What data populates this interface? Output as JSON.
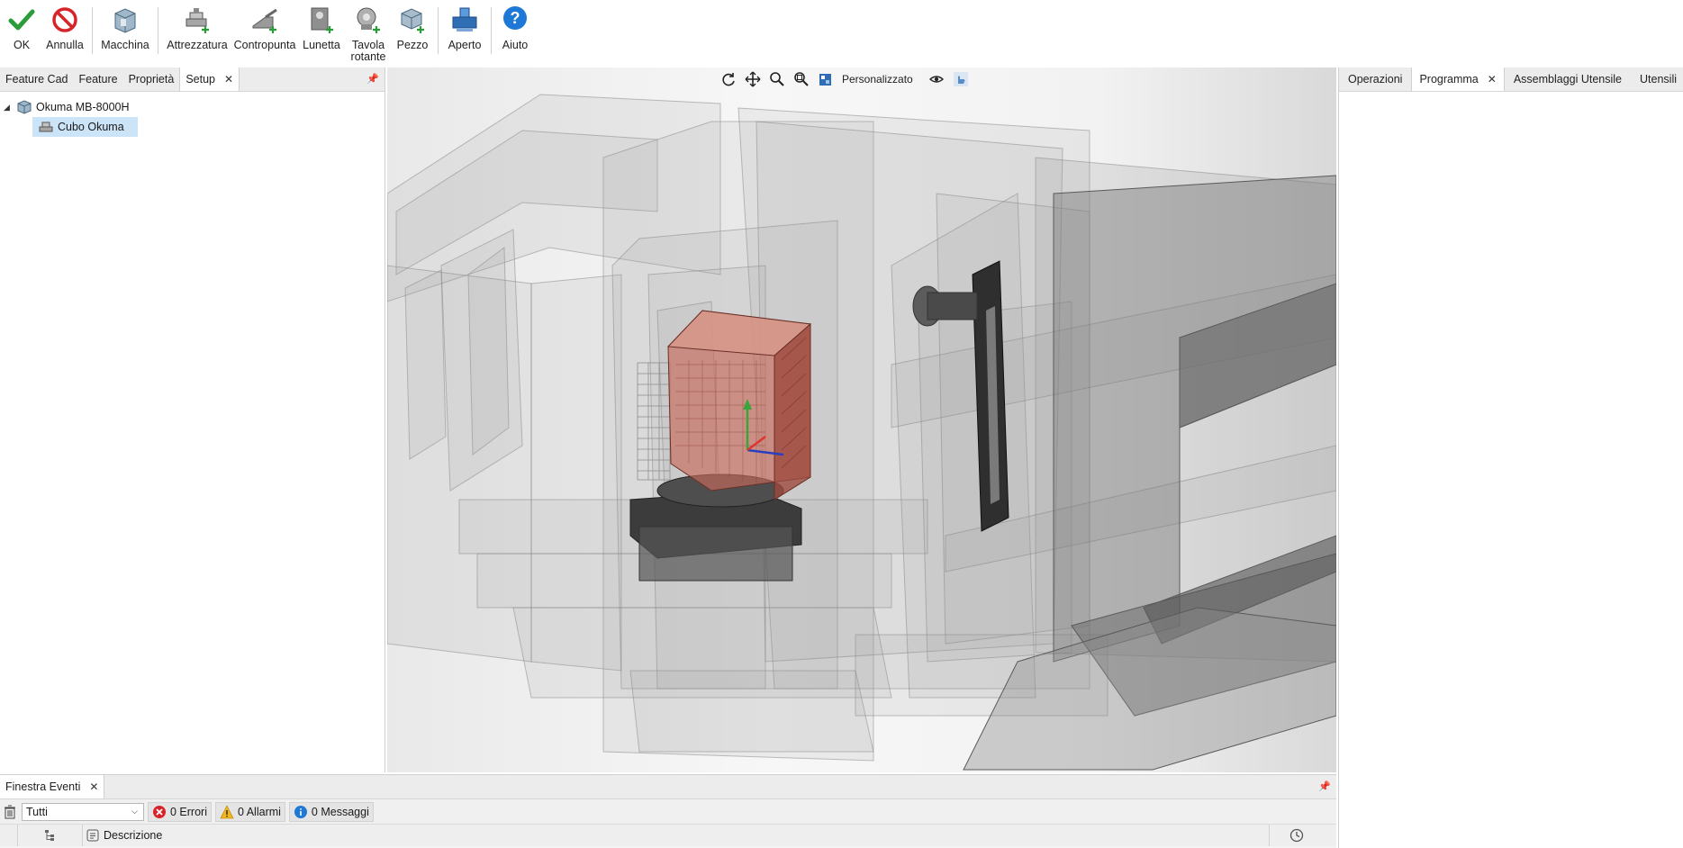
{
  "toolbar": {
    "ok": "OK",
    "annulla": "Annulla",
    "macchina": "Macchina",
    "attrezzatura": "Attrezzatura",
    "contropunta": "Contropunta",
    "lunetta": "Lunetta",
    "tavola_line1": "Tavola",
    "tavola_line2": "rotante",
    "pezzo": "Pezzo",
    "aperto": "Aperto",
    "aiuto": "Aiuto"
  },
  "left_tabs": [
    "Feature Cad",
    "Feature",
    "Proprietà",
    "Setup"
  ],
  "tree": {
    "root": "Okuma MB-8000H",
    "child": "Cubo Okuma"
  },
  "viewport": {
    "view_mode": "Personalizzato"
  },
  "right_tabs": [
    "Operazioni",
    "Programma",
    "Assemblaggi Utensile",
    "Utensili"
  ],
  "events": {
    "title": "Finestra Eventi",
    "filter": "Tutti",
    "errors": "0 Errori",
    "alarms": "0 Allarmi",
    "messages": "0 Messaggi",
    "col_description": "Descrizione"
  },
  "colors": {
    "ok_green": "#2a9d3a",
    "cancel_red": "#d6242a",
    "help_blue": "#1e78d6",
    "selection": "#cce4f7",
    "workpiece": "#c86a5a"
  }
}
